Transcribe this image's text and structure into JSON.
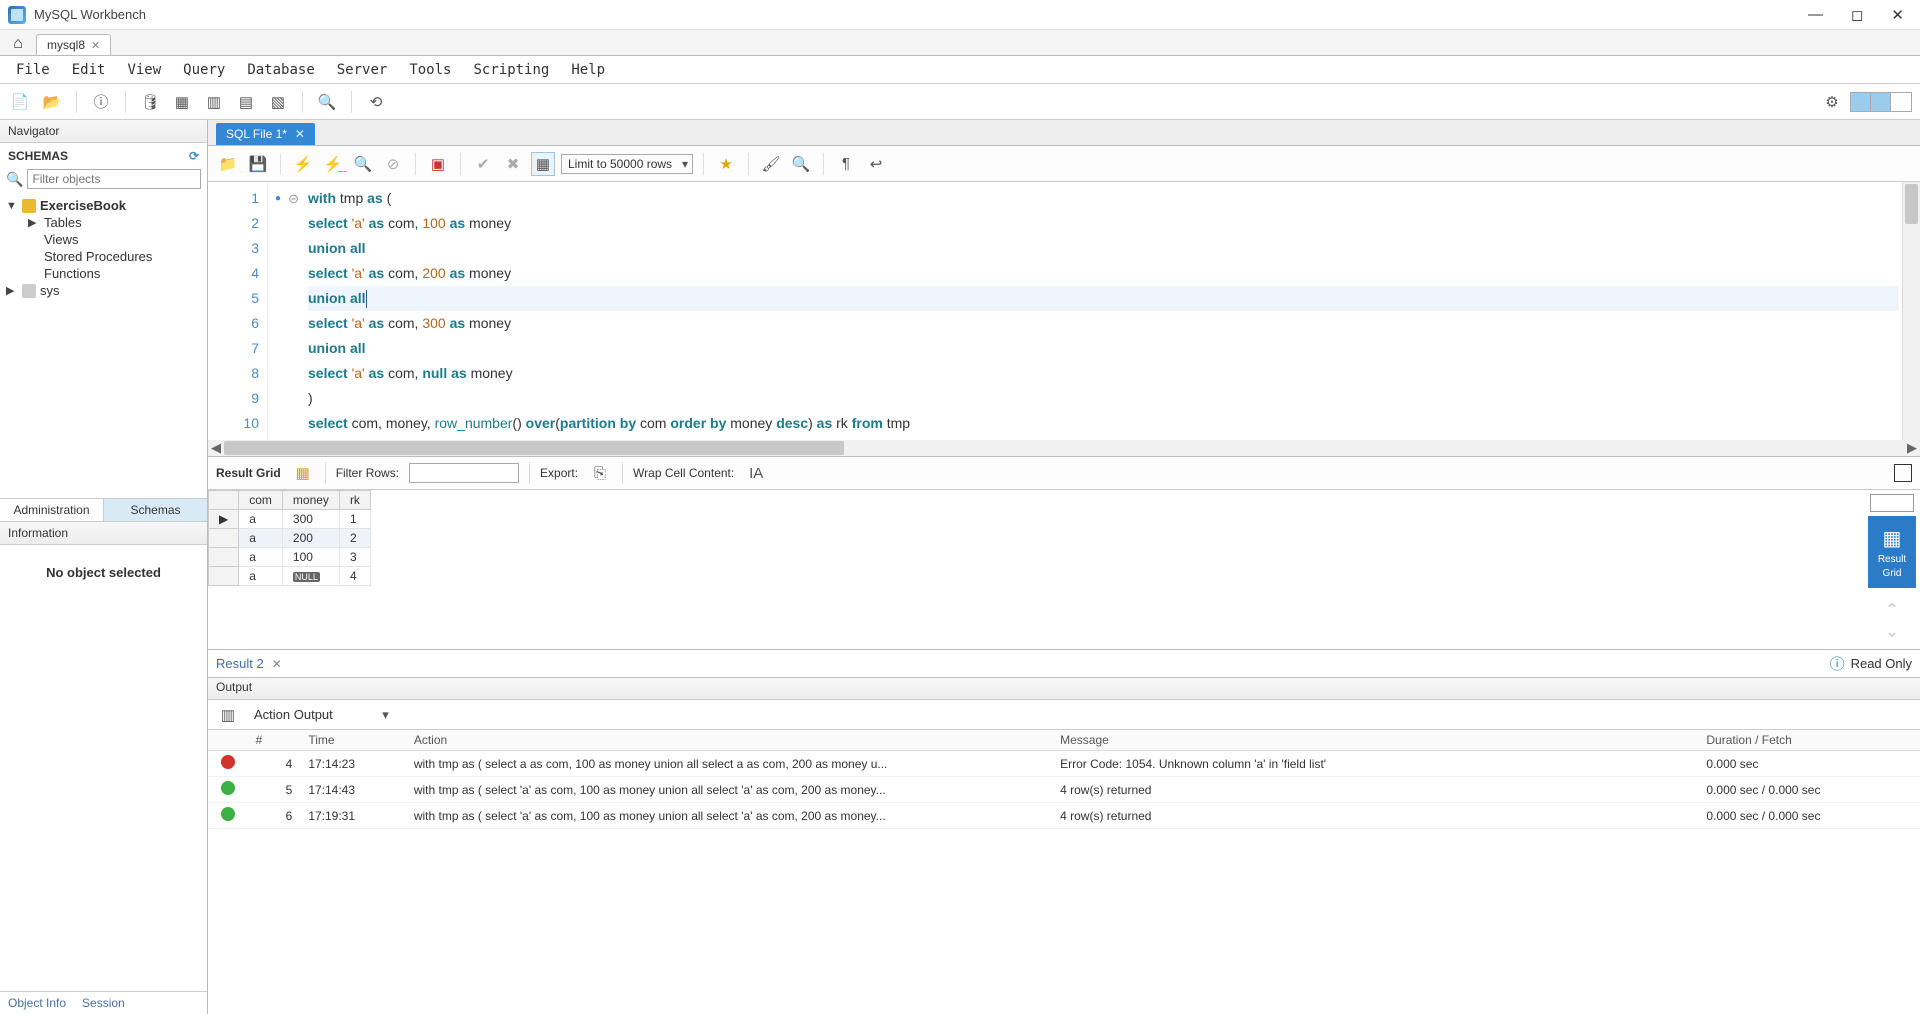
{
  "app": {
    "title": "MySQL Workbench"
  },
  "connection_tab": {
    "name": "mysql8"
  },
  "menu": {
    "file": "File",
    "edit": "Edit",
    "view": "View",
    "query": "Query",
    "database": "Database",
    "server": "Server",
    "tools": "Tools",
    "scripting": "Scripting",
    "help": "Help"
  },
  "navigator": {
    "title": "Navigator",
    "schemas_label": "SCHEMAS",
    "filter_placeholder": "Filter objects",
    "tree": {
      "db": "ExerciseBook",
      "tables": "Tables",
      "views": "Views",
      "storedproc": "Stored Procedures",
      "functions": "Functions",
      "sys": "sys"
    },
    "tabs": {
      "admin": "Administration",
      "schemas": "Schemas"
    },
    "info_title": "Information",
    "info_body": "No object selected",
    "info_tabs": {
      "objinfo": "Object Info",
      "session": "Session"
    }
  },
  "file_tab": {
    "label": "SQL File 1*"
  },
  "editor_toolbar": {
    "limit": "Limit to 50000 rows"
  },
  "sql": {
    "l1": "with tmp as (",
    "l2": "select 'a' as com, 100 as money",
    "l3": "union all",
    "l4": "select 'a' as com, 200 as money",
    "l5": "union all",
    "l6": "select 'a' as com, 300 as money",
    "l7": "union all",
    "l8": "select 'a' as com, null as money",
    "l9": ")",
    "l10": "select com, money, row_number() over(partition by com order by money desc) as rk from tmp"
  },
  "results_toolbar": {
    "result_grid": "Result Grid",
    "filter_rows": "Filter Rows:",
    "export": "Export:",
    "wrap": "Wrap Cell Content:"
  },
  "grid": {
    "headers": {
      "com": "com",
      "money": "money",
      "rk": "rk"
    },
    "rows": [
      {
        "com": "a",
        "money": "300",
        "rk": "1"
      },
      {
        "com": "a",
        "money": "200",
        "rk": "2"
      },
      {
        "com": "a",
        "money": "100",
        "rk": "3"
      },
      {
        "com": "a",
        "money": "NULL",
        "rk": "4"
      }
    ]
  },
  "result_side": {
    "tile_label1": "Result",
    "tile_label2": "Grid"
  },
  "result_tab": {
    "label": "Result 2",
    "readonly": "Read Only"
  },
  "output": {
    "title": "Output",
    "dropdown": "Action Output",
    "headers": {
      "num": "#",
      "time": "Time",
      "action": "Action",
      "message": "Message",
      "duration": "Duration / Fetch"
    },
    "rows": [
      {
        "status": "err",
        "num": "4",
        "time": "17:14:23",
        "action": "with tmp as ( select a as com, 100 as money union all select a as com, 200 as money u...",
        "message": "Error Code: 1054. Unknown column 'a' in 'field list'",
        "duration": "0.000 sec"
      },
      {
        "status": "ok",
        "num": "5",
        "time": "17:14:43",
        "action": "with tmp as ( select 'a' as com, 100 as money union all select 'a' as com, 200 as money...",
        "message": "4 row(s) returned",
        "duration": "0.000 sec / 0.000 sec"
      },
      {
        "status": "ok",
        "num": "6",
        "time": "17:19:31",
        "action": "with tmp as ( select 'a' as com, 100 as money union all select 'a' as com, 200 as money...",
        "message": "4 row(s) returned",
        "duration": "0.000 sec / 0.000 sec"
      }
    ]
  }
}
